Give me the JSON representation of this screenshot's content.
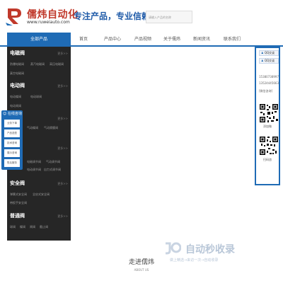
{
  "header": {
    "logo_name": "儒炜自动化",
    "logo_url": "www.ruweiauto.com",
    "slogan": "专注产品，专业信赖!",
    "search_placeholder": "请输入产品的名称"
  },
  "nav": {
    "category_title": "全部产品",
    "items": [
      "首页",
      "产品中心",
      "产品视频",
      "关于儒炜",
      "新闻资讯",
      "联系我们"
    ]
  },
  "sidebar": {
    "sections": [
      {
        "title": "电磁阀",
        "more": "更多>>",
        "subs": [
          "防爆电磁阀",
          "蒸汽电磁阀",
          "高压电磁阀",
          "真空电磁阀"
        ]
      },
      {
        "title": "电动阀",
        "more": "更多>>",
        "subs": [
          "电动蝶阀",
          "电动球阀",
          "电动闸阀"
        ]
      },
      {
        "title": "",
        "more": "更多>>",
        "subs": [
          "气动蝶阀",
          "气动隔膜阀"
        ]
      },
      {
        "title": "",
        "more": "更多>>",
        "subs": [
          "电磁调节阀",
          "气动调节阀",
          "电动调节阀",
          "自力式调节阀"
        ]
      },
      {
        "title": "安全阀",
        "more": "更多>>",
        "subs": [
          "弹簧式安全阀",
          "全启式安全阀",
          "带扳手安全阀"
        ]
      },
      {
        "title": "普通阀",
        "more": "更多>>",
        "subs": [
          "球阀",
          "蝶阀",
          "闸阀",
          "截止阀"
        ]
      }
    ]
  },
  "online": {
    "title": "在线咨询",
    "items": [
      "业务下单",
      "产品选型",
      "技术咨询",
      "展示咨询",
      "售后服务"
    ]
  },
  "contact": {
    "qq1": "QQ交谈",
    "qq2": "QQ交谈",
    "phone1": "15380738997",
    "phone2": "13524445663",
    "wechat": "[微信咨询]",
    "qr1_label": "添加微",
    "qr2_label": "扫码咨"
  },
  "about": {
    "title": "走进儒炜",
    "subtitle": "ABOUT US"
  },
  "watermark": {
    "text": "自动秒收录",
    "sub": "做上精选→来访一次→自动收录"
  },
  "colors": {
    "brand_blue": "#1f6bb5",
    "logo_red": "#c0392b",
    "sidebar_bg": "#262626"
  }
}
